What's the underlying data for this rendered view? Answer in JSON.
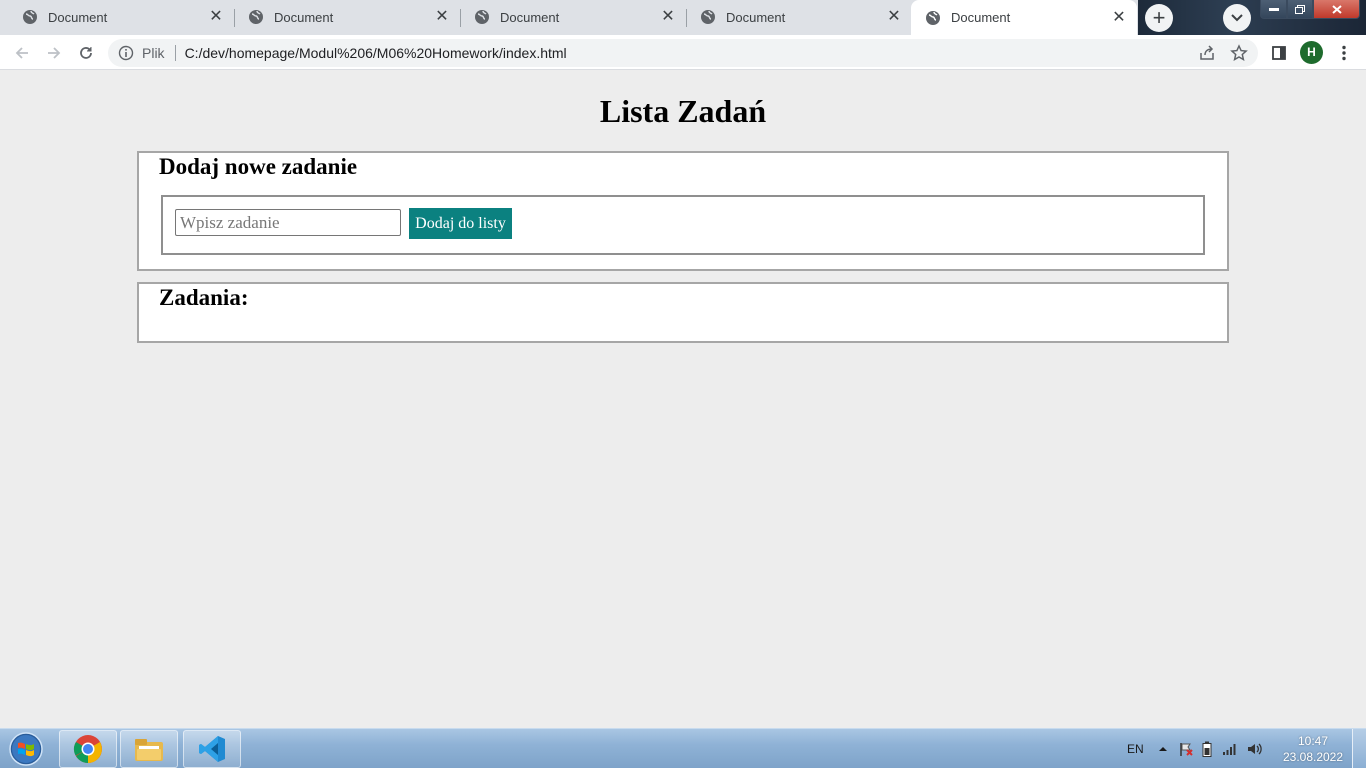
{
  "browser": {
    "tabs": [
      {
        "title": "Document",
        "active": false
      },
      {
        "title": "Document",
        "active": false
      },
      {
        "title": "Document",
        "active": false
      },
      {
        "title": "Document",
        "active": false
      },
      {
        "title": "Document",
        "active": true
      }
    ],
    "address": {
      "chip": "Plik",
      "url": "C:/dev/homepage/Modul%206/M06%20Homework/index.html"
    },
    "profile_initial": "H"
  },
  "page": {
    "title": "Lista Zadań",
    "add_section": {
      "heading": "Dodaj nowe zadanie",
      "input_placeholder": "Wpisz zadanie",
      "input_value": "",
      "button_label": "Dodaj do listy"
    },
    "list_section": {
      "heading": "Zadania:",
      "items": []
    },
    "colors": {
      "button_bg": "#0b8180",
      "page_bg": "#ededed",
      "panel_border": "#a6a6a6"
    }
  },
  "taskbar": {
    "apps": [
      {
        "name": "chrome-icon"
      },
      {
        "name": "file-explorer-icon"
      },
      {
        "name": "vscode-icon"
      }
    ],
    "language": "EN",
    "time": "10:47",
    "date": "23.08.2022"
  }
}
